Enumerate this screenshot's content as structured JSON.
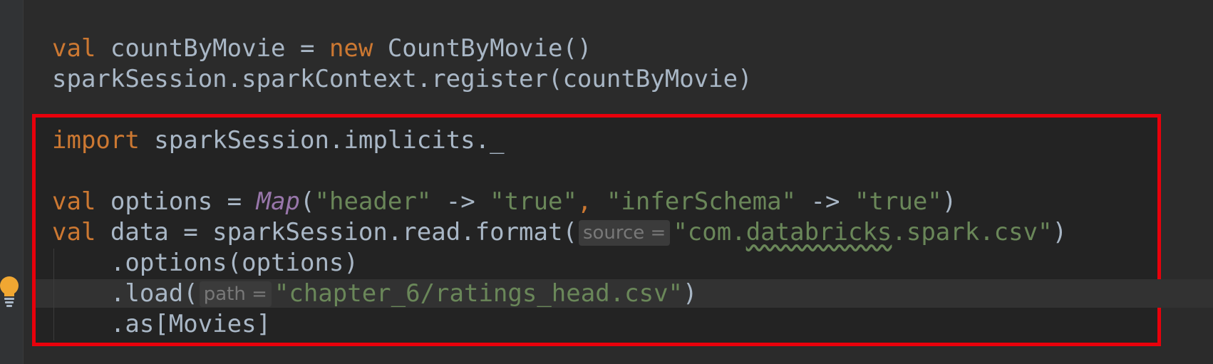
{
  "code": {
    "line_top_fragment": "  {",
    "line1": {
      "kw": "val",
      "rest_a": " countByMovie = ",
      "kw2": "new",
      "rest_b": " CountByMovie()"
    },
    "line2": "sparkSession.sparkContext.register(countByMovie)",
    "line3": {
      "kw": "import",
      "rest": " sparkSession.implicits._"
    },
    "line4": {
      "kw": "val",
      "rest_a": " options = ",
      "map": "Map",
      "paren_open": "(",
      "s1": "\"header\"",
      "arrow1": " -> ",
      "s2": "\"true\"",
      "comma": ", ",
      "s3": "\"inferSchema\"",
      "arrow2": " -> ",
      "s4": "\"true\"",
      "paren_close": ")"
    },
    "line5": {
      "kw": "val",
      "rest_a": " data = sparkSession.read.format(",
      "hint": "source =",
      "s_pre": "\"com.",
      "s_squiggle": "databricks",
      "s_post": ".spark.csv\"",
      "close": ")"
    },
    "line6": "    .options(options)",
    "line7": {
      "pre": "    .load(",
      "hint": "path =",
      "str": "\"chapter_6/ratings_head.csv\"",
      "close": ")"
    },
    "line8": "    .as[Movies]"
  },
  "colors": {
    "background": "#2b2b2b",
    "keyword": "#cc7832",
    "string": "#6a8759",
    "highlight_border": "#e8000b",
    "intention_bulb": "#f0a732"
  },
  "icons": {
    "gutter_icon": "lightbulb-icon"
  }
}
